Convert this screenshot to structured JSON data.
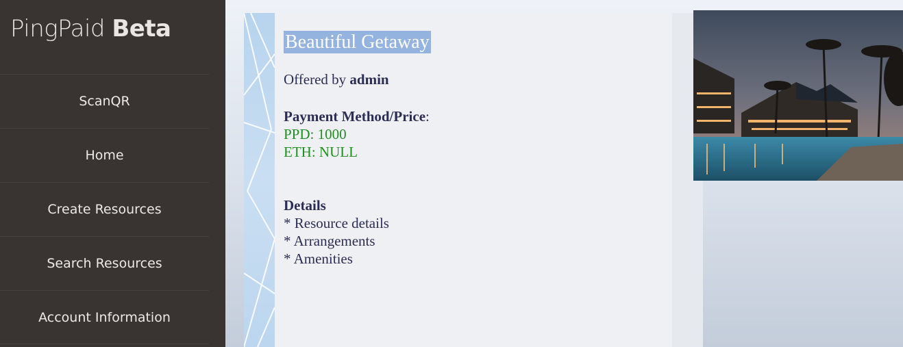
{
  "brand": {
    "name": "PingPaid",
    "tag": "Beta"
  },
  "nav": [
    {
      "label": "ScanQR"
    },
    {
      "label": "Home"
    },
    {
      "label": "Create Resources"
    },
    {
      "label": "Search Resources"
    },
    {
      "label": "Account Information"
    }
  ],
  "resource": {
    "title": "Beautiful Getaway",
    "offered_prefix": "Offered by",
    "offered_by": "admin",
    "payment_label": "Payment Method/Price",
    "payment_colon": ":",
    "prices": [
      "PPD: 1000",
      "ETH: NULL"
    ],
    "details_label": "Details",
    "details": [
      "* Resource details",
      "* Arrangements",
      "* Amenities"
    ]
  },
  "colors": {
    "sidebar": "#393431",
    "title_highlight": "#95b3df",
    "price_green": "#1f8f1f",
    "text": "#2c2d52"
  },
  "image": {
    "icon": "resort-pool-photo"
  }
}
